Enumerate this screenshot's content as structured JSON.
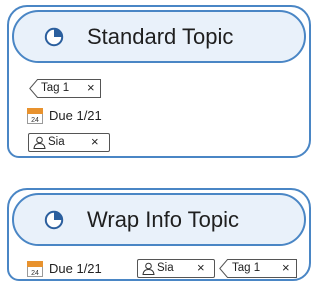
{
  "topics": [
    {
      "title": "Standard Topic",
      "tag": {
        "label": "Tag 1",
        "remove": "×"
      },
      "due": {
        "icon_text": "24",
        "label": "Due 1/21"
      },
      "assignee": {
        "label": "Sia",
        "remove": "×"
      }
    },
    {
      "title": "Wrap Info Topic",
      "due": {
        "icon_text": "24",
        "label": "Due 1/21"
      },
      "assignee": {
        "label": "Sia",
        "remove": "×"
      },
      "tag": {
        "label": "Tag 1",
        "remove": "×"
      }
    }
  ],
  "colors": {
    "border": "#4a86c5",
    "header_fill": "#e9f1fa",
    "calendar_orange": "#e8922e"
  },
  "icons": {
    "progress": "progress-pie-icon",
    "calendar": "calendar-icon",
    "person": "person-icon"
  }
}
